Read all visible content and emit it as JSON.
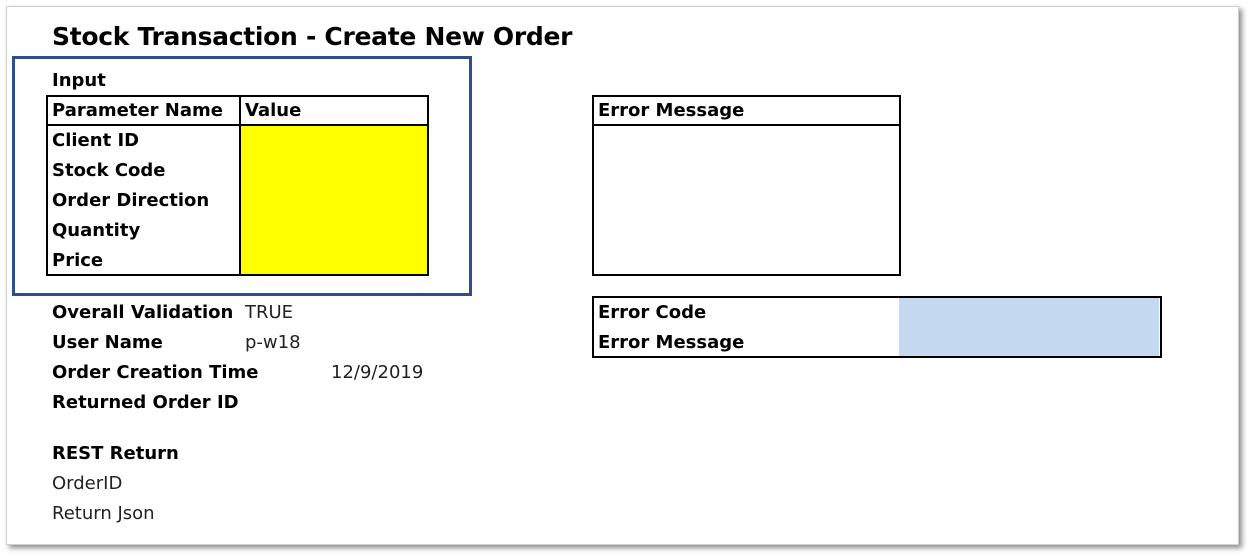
{
  "title": "Stock Transaction - Create New Order",
  "input": {
    "section_label": "Input",
    "col_param": "Parameter Name",
    "col_value": "Value",
    "rows": [
      "Client ID",
      "Stock Code",
      "Order Direction",
      "Quantity",
      "Price"
    ],
    "values": [
      "",
      "",
      "",
      "",
      ""
    ]
  },
  "error_panel": {
    "header": "Error Message",
    "body": ""
  },
  "error_result": {
    "code_label": "Error Code",
    "code_value": "",
    "message_label": "Error Message",
    "message_value": ""
  },
  "status": {
    "overall_label": "Overall Validation",
    "overall_value": "TRUE",
    "user_label": "User Name",
    "user_value": "p-w18",
    "time_label": "Order Creation Time",
    "time_value": "12/9/2019",
    "order_id_label": "Returned Order ID",
    "order_id_value": ""
  },
  "rest": {
    "heading": "REST Return",
    "orderid_label": "OrderID",
    "json_label": "Return Json"
  },
  "colors": {
    "input_fill": "#ffff00",
    "output_fill": "#c5d9f1",
    "highlight_border": "#2e4d8e"
  }
}
